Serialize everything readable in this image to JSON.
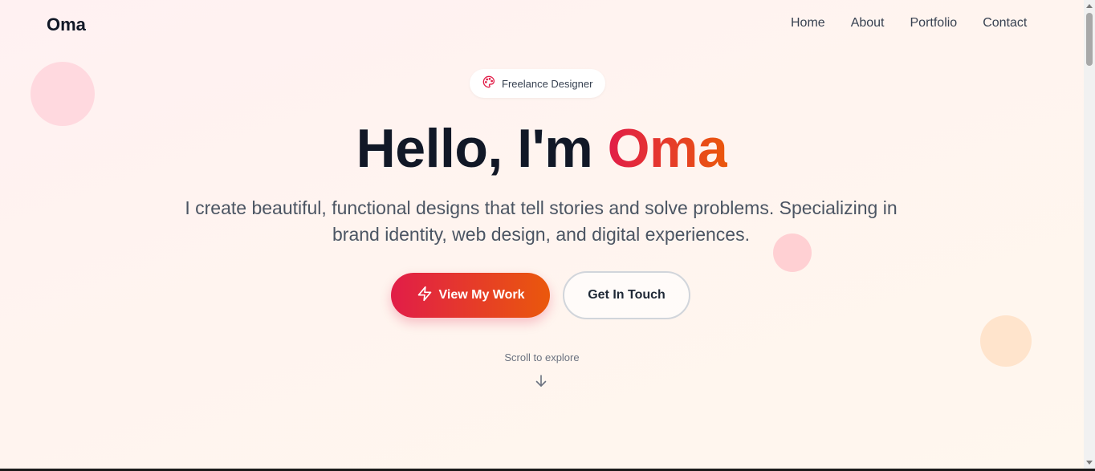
{
  "brand": {
    "name": "Oma"
  },
  "nav": {
    "items": [
      {
        "label": "Home"
      },
      {
        "label": "About"
      },
      {
        "label": "Portfolio"
      },
      {
        "label": "Contact"
      }
    ]
  },
  "hero": {
    "badge": {
      "icon": "palette-icon",
      "label": "Freelance Designer"
    },
    "title_prefix": "Hello, I'm ",
    "title_accent": "Oma",
    "subtitle": "I create beautiful, functional designs that tell stories and solve problems. Specializing in brand identity, web design, and digital experiences.",
    "primary_button": {
      "icon": "lightning-icon",
      "label": "View My Work"
    },
    "secondary_button": {
      "label": "Get In Touch"
    },
    "scroll_hint": "Scroll to explore",
    "scroll_icon": "arrow-down-icon"
  },
  "colors": {
    "accent_start": "#e11d48",
    "accent_end": "#ea580c",
    "text_dark": "#111827",
    "text_muted": "#4b5563"
  }
}
